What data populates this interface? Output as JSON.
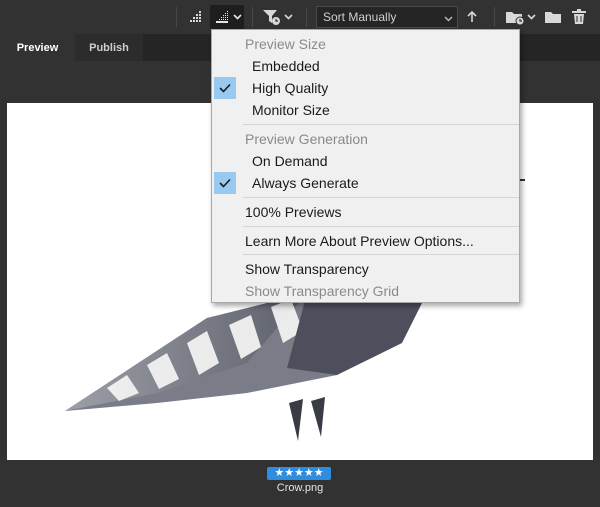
{
  "toolbar": {
    "sort": {
      "value": "Sort Manually"
    },
    "icons": [
      "preview-size-icon",
      "preview-quality-icon",
      "filter-icon",
      "sort-direction-icon",
      "new-folder-icon",
      "folder-icon",
      "trash-icon"
    ]
  },
  "tabs": [
    {
      "label": "Preview",
      "active": true
    },
    {
      "label": "Publish",
      "active": false
    }
  ],
  "menu": {
    "preview_size_header": "Preview Size",
    "embedded": "Embedded",
    "high_quality": "High Quality",
    "monitor_size": "Monitor Size",
    "preview_generation_header": "Preview Generation",
    "on_demand": "On Demand",
    "always_generate": "Always Generate",
    "previews_100": "100% Previews",
    "learn_more": "Learn More About Preview Options...",
    "show_transparency": "Show Transparency",
    "show_transparency_grid": "Show Transparency Grid",
    "checked": [
      "High Quality",
      "Always Generate"
    ]
  },
  "file": {
    "rating_stars": "★★★★★",
    "rating_value": 5,
    "name": "Crow.png"
  },
  "colors": {
    "accent": "#2f8de0",
    "check_highlight": "#99c9ef",
    "menu_bg": "#f0f0f0",
    "panel_bg": "#323232"
  }
}
